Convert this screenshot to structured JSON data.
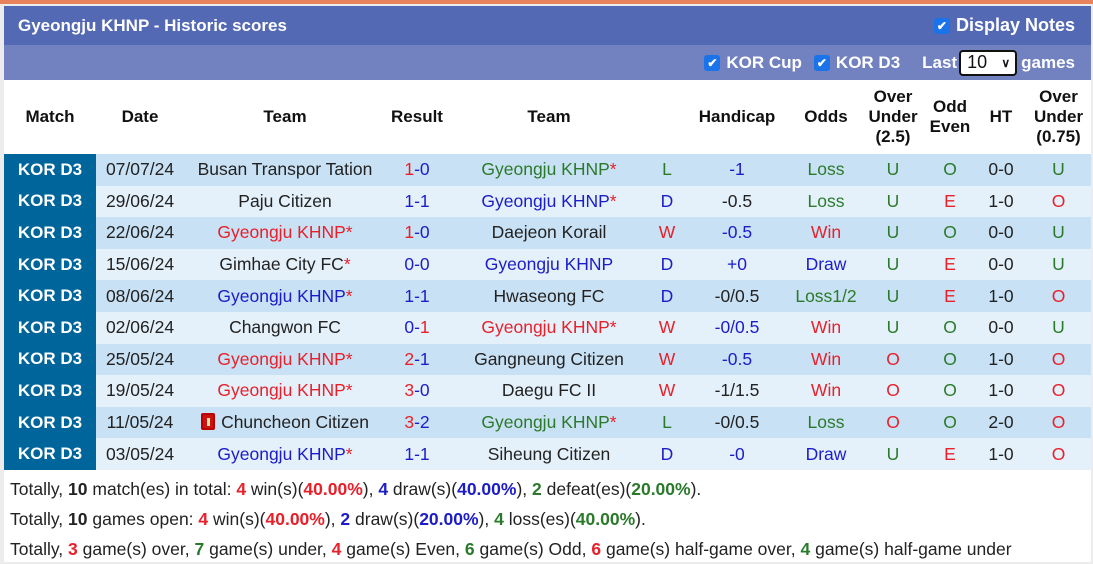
{
  "title": "Gyeongju KHNP - Historic scores",
  "display_notes": {
    "label": "Display Notes",
    "checked": true
  },
  "filters": {
    "kor_cup": {
      "label": "KOR Cup",
      "checked": true
    },
    "kor_d3": {
      "label": "KOR D3",
      "checked": true
    },
    "last_label": "Last",
    "last_value": "10",
    "games_label": "games"
  },
  "headers": [
    "Match",
    "Date",
    "Team",
    "Result",
    "Team",
    "",
    "Handicap",
    "Odds",
    "Over Under (2.5)",
    "Odd Even",
    "HT",
    "Over Under (0.75)"
  ],
  "rows": [
    {
      "league": "KOR D3",
      "date": "07/07/24",
      "home": "Busan Transpor Tation",
      "home_color": "dark",
      "home_star": false,
      "hs": "1",
      "as": "0",
      "hs_color": "red",
      "as_color": "blue",
      "away": "Gyeongju KHNP",
      "away_color": "green",
      "away_star": true,
      "wdl": "L",
      "wdl_color": "green",
      "handicap": "-1",
      "hcp_color": "blue",
      "odds": "Loss",
      "odds_color": "green",
      "ou": "U",
      "ou_color": "green",
      "oe": "O",
      "oe_color": "green",
      "ht": "0-0",
      "ou2": "U",
      "ou2_color": "green",
      "red_card": false
    },
    {
      "league": "KOR D3",
      "date": "29/06/24",
      "home": "Paju Citizen",
      "home_color": "dark",
      "home_star": false,
      "hs": "1",
      "as": "1",
      "hs_color": "blue",
      "as_color": "blue",
      "away": "Gyeongju KHNP",
      "away_color": "blue",
      "away_star": true,
      "wdl": "D",
      "wdl_color": "blue",
      "handicap": "-0.5",
      "hcp_color": "dark",
      "odds": "Loss",
      "odds_color": "green",
      "ou": "U",
      "ou_color": "green",
      "oe": "E",
      "oe_color": "red",
      "ht": "1-0",
      "ou2": "O",
      "ou2_color": "red",
      "red_card": false
    },
    {
      "league": "KOR D3",
      "date": "22/06/24",
      "home": "Gyeongju KHNP",
      "home_color": "red",
      "home_star": true,
      "hs": "1",
      "as": "0",
      "hs_color": "red",
      "as_color": "blue",
      "away": "Daejeon Korail",
      "away_color": "dark",
      "away_star": false,
      "wdl": "W",
      "wdl_color": "red",
      "handicap": "-0.5",
      "hcp_color": "blue",
      "odds": "Win",
      "odds_color": "red",
      "ou": "U",
      "ou_color": "green",
      "oe": "O",
      "oe_color": "green",
      "ht": "0-0",
      "ou2": "U",
      "ou2_color": "green",
      "red_card": false
    },
    {
      "league": "KOR D3",
      "date": "15/06/24",
      "home": "Gimhae City FC",
      "home_color": "dark",
      "home_star": true,
      "hs": "0",
      "as": "0",
      "hs_color": "blue",
      "as_color": "blue",
      "away": "Gyeongju KHNP",
      "away_color": "blue",
      "away_star": false,
      "wdl": "D",
      "wdl_color": "blue",
      "handicap": "+0",
      "hcp_color": "blue",
      "odds": "Draw",
      "odds_color": "blue",
      "ou": "U",
      "ou_color": "green",
      "oe": "E",
      "oe_color": "red",
      "ht": "0-0",
      "ou2": "U",
      "ou2_color": "green",
      "red_card": false
    },
    {
      "league": "KOR D3",
      "date": "08/06/24",
      "home": "Gyeongju KHNP",
      "home_color": "blue",
      "home_star": true,
      "hs": "1",
      "as": "1",
      "hs_color": "blue",
      "as_color": "blue",
      "away": "Hwaseong FC",
      "away_color": "dark",
      "away_star": false,
      "wdl": "D",
      "wdl_color": "blue",
      "handicap": "-0/0.5",
      "hcp_color": "dark",
      "odds": "Loss1/2",
      "odds_color": "green",
      "ou": "U",
      "ou_color": "green",
      "oe": "E",
      "oe_color": "red",
      "ht": "1-0",
      "ou2": "O",
      "ou2_color": "red",
      "red_card": false
    },
    {
      "league": "KOR D3",
      "date": "02/06/24",
      "home": "Changwon FC",
      "home_color": "dark",
      "home_star": false,
      "hs": "0",
      "as": "1",
      "hs_color": "blue",
      "as_color": "red",
      "away": "Gyeongju KHNP",
      "away_color": "red",
      "away_star": true,
      "wdl": "W",
      "wdl_color": "red",
      "handicap": "-0/0.5",
      "hcp_color": "blue",
      "odds": "Win",
      "odds_color": "red",
      "ou": "U",
      "ou_color": "green",
      "oe": "O",
      "oe_color": "green",
      "ht": "0-0",
      "ou2": "U",
      "ou2_color": "green",
      "red_card": false
    },
    {
      "league": "KOR D3",
      "date": "25/05/24",
      "home": "Gyeongju KHNP",
      "home_color": "red",
      "home_star": true,
      "hs": "2",
      "as": "1",
      "hs_color": "red",
      "as_color": "blue",
      "away": "Gangneung Citizen",
      "away_color": "dark",
      "away_star": false,
      "wdl": "W",
      "wdl_color": "red",
      "handicap": "-0.5",
      "hcp_color": "blue",
      "odds": "Win",
      "odds_color": "red",
      "ou": "O",
      "ou_color": "red",
      "oe": "O",
      "oe_color": "green",
      "ht": "1-0",
      "ou2": "O",
      "ou2_color": "red",
      "red_card": false
    },
    {
      "league": "KOR D3",
      "date": "19/05/24",
      "home": "Gyeongju KHNP",
      "home_color": "red",
      "home_star": true,
      "hs": "3",
      "as": "0",
      "hs_color": "red",
      "as_color": "blue",
      "away": "Daegu FC II",
      "away_color": "dark",
      "away_star": false,
      "wdl": "W",
      "wdl_color": "red",
      "handicap": "-1/1.5",
      "hcp_color": "dark",
      "odds": "Win",
      "odds_color": "red",
      "ou": "O",
      "ou_color": "red",
      "oe": "O",
      "oe_color": "green",
      "ht": "1-0",
      "ou2": "O",
      "ou2_color": "red",
      "red_card": false
    },
    {
      "league": "KOR D3",
      "date": "11/05/24",
      "home": "Chuncheon Citizen",
      "home_color": "dark",
      "home_star": false,
      "hs": "3",
      "as": "2",
      "hs_color": "red",
      "as_color": "blue",
      "away": "Gyeongju KHNP",
      "away_color": "green",
      "away_star": true,
      "wdl": "L",
      "wdl_color": "green",
      "handicap": "-0/0.5",
      "hcp_color": "dark",
      "odds": "Loss",
      "odds_color": "green",
      "ou": "O",
      "ou_color": "red",
      "oe": "O",
      "oe_color": "green",
      "ht": "2-0",
      "ou2": "O",
      "ou2_color": "red",
      "red_card": true
    },
    {
      "league": "KOR D3",
      "date": "03/05/24",
      "home": "Gyeongju KHNP",
      "home_color": "blue",
      "home_star": true,
      "hs": "1",
      "as": "1",
      "hs_color": "blue",
      "as_color": "blue",
      "away": "Siheung Citizen",
      "away_color": "dark",
      "away_star": false,
      "wdl": "D",
      "wdl_color": "blue",
      "handicap": "-0",
      "hcp_color": "blue",
      "odds": "Draw",
      "odds_color": "blue",
      "ou": "U",
      "ou_color": "green",
      "oe": "E",
      "oe_color": "red",
      "ht": "1-0",
      "ou2": "O",
      "ou2_color": "red",
      "red_card": false
    }
  ],
  "summary": {
    "line1": {
      "prefix": "Totally, ",
      "total": "10",
      "t1": " match(es) in total: ",
      "wins": "4",
      "t2": " win(s)(",
      "win_pct": "40.00%",
      "t3": "), ",
      "draws": "4",
      "t4": " draw(s)(",
      "draw_pct": "40.00%",
      "t5": "), ",
      "defeats": "2",
      "t6": " defeat(es)(",
      "defeat_pct": "20.00%",
      "t7": ")."
    },
    "line2": {
      "prefix": "Totally, ",
      "total": "10",
      "t1": " games open: ",
      "wins": "4",
      "t2": " win(s)(",
      "win_pct": "40.00%",
      "t3": "), ",
      "draws": "2",
      "t4": " draw(s)(",
      "draw_pct": "20.00%",
      "t5": "), ",
      "losses": "4",
      "t6": " loss(es)(",
      "loss_pct": "40.00%",
      "t7": ")."
    },
    "line3": {
      "prefix": "Totally, ",
      "over": "3",
      "t1": " game(s) over, ",
      "under": "7",
      "t2": " game(s) under, ",
      "even": "4",
      "t3": " game(s) Even, ",
      "odd": "6",
      "t4": " game(s) Odd, ",
      "hg_over": "6",
      "t5": " game(s) half-game over, ",
      "hg_under": "4",
      "t6": " game(s) half-game under"
    }
  }
}
